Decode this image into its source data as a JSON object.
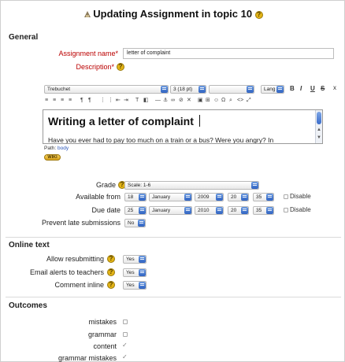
{
  "page": {
    "title": "Updating Assignment in topic 10"
  },
  "general": {
    "section_label": "General",
    "assignment_name_label": "Assignment name",
    "assignment_name_value": "letter of complaint",
    "description_label": "Description",
    "required_mark": "*",
    "toolbar": {
      "font_family": "Trebuchet",
      "font_size": "3 (18 pt)",
      "block_format": "",
      "language": "Lang",
      "bold": "B",
      "italic": "I",
      "underline": "U",
      "strike": "S"
    },
    "editor": {
      "heading": "Writing a letter of complaint",
      "paragraph": "Have you ever had to pay too much on a train or a bus? Were you angry? In",
      "path_label": "Path:",
      "path_value": "body"
    },
    "wiki_badge": "WIKI"
  },
  "grading": {
    "grade_label": "Grade",
    "grade_value": "Scale: 1-6",
    "available_from_label": "Available from",
    "available_from": {
      "day": "18",
      "month": "January",
      "year": "2009",
      "hour": "20",
      "minute": "35",
      "disable": "Disable"
    },
    "due_date_label": "Due date",
    "due_date": {
      "day": "25",
      "month": "January",
      "year": "2010",
      "hour": "20",
      "minute": "35",
      "disable": "Disable"
    },
    "prevent_late_label": "Prevent late submissions",
    "prevent_late_value": "No"
  },
  "online_text": {
    "section_label": "Online text",
    "allow_resubmitting_label": "Allow resubmitting",
    "allow_resubmitting_value": "Yes",
    "email_alerts_label": "Email alerts to teachers",
    "email_alerts_value": "Yes",
    "comment_inline_label": "Comment inline",
    "comment_inline_value": "Yes"
  },
  "outcomes": {
    "section_label": "Outcomes",
    "items": [
      {
        "label": "mistakes",
        "checked": false
      },
      {
        "label": "grammar",
        "checked": false
      },
      {
        "label": "content",
        "checked": true
      },
      {
        "label": "grammar mistakes",
        "checked": true
      }
    ]
  },
  "colors": {
    "required_red": "#b00000",
    "select_arrow_blue": "#2f63c2",
    "help_yellow": "#e3b416"
  }
}
